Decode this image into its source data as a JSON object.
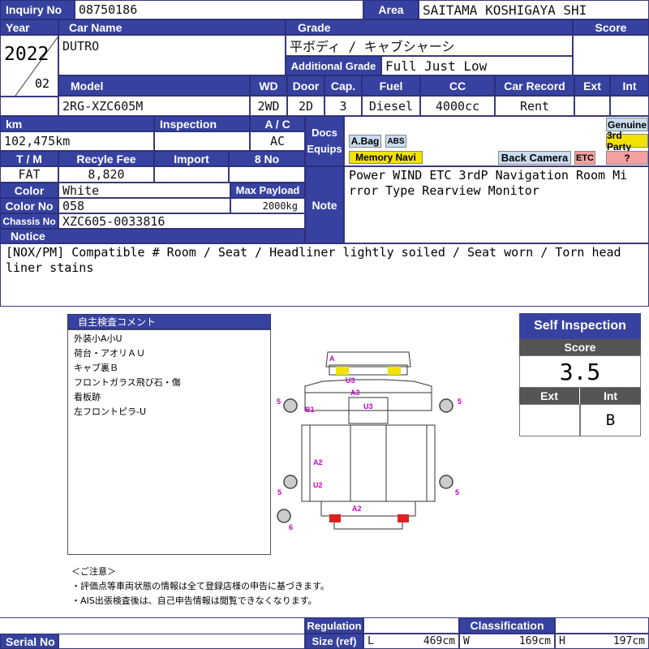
{
  "labels": {
    "inquiry_no": "Inquiry No",
    "area": "Area",
    "year": "Year",
    "car_name": "Car Name",
    "grade": "Grade",
    "score": "Score",
    "additional_grade": "Additional Grade",
    "model": "Model",
    "wd": "WD",
    "door": "Door",
    "cap": "Cap.",
    "fuel": "Fuel",
    "cc": "CC",
    "car_record": "Car Record",
    "ext": "Ext",
    "int": "Int",
    "km": "km",
    "inspection": "Inspection",
    "ac": "A / C",
    "docs": "Docs",
    "equips": "Equips",
    "tm": "T / M",
    "recycle_fee": "Recyle Fee",
    "import": "Import",
    "eight_no": "8 No",
    "color": "Color",
    "max_payload": "Max Payload",
    "color_no": "Color No",
    "note": "Note",
    "chassis_no": "Chassis No",
    "notice": "Notice",
    "serial_no": "Serial No",
    "regulation": "Regulation",
    "size_ref": "Size (ref)",
    "classification": "Classification",
    "L": "L",
    "W": "W",
    "H": "H"
  },
  "values": {
    "inquiry_no": "08750186",
    "area": "SAITAMA KOSHIGAYA SHI",
    "year": "2022",
    "month": "02",
    "car_name": "DUTRO",
    "grade": "平ボディ / キャブシャーシ",
    "additional_grade": "Full Just Low",
    "model": "2RG-XZC605M",
    "wd": "2WD",
    "door": "2D",
    "cap": "3",
    "fuel": "Diesel",
    "cc": "4000cc",
    "car_record": "Rent",
    "km": "102,475km",
    "ac": "AC",
    "tm": "FAT",
    "recycle_fee": "8,820",
    "color": "White",
    "max_payload": "2000kg",
    "color_no": "058",
    "chassis_no": "XZC605-0033816",
    "note_line1": "Power WIND ETC 3rdP Navigation Room Mi",
    "note_line2": "rror Type Rearview Monitor",
    "notice_line1": "[NOX/PM] Compatible # Room / Seat / Headliner lightly soiled / Seat worn / Torn head",
    "notice_line2": "liner stains",
    "size_L": "469cm",
    "size_W": "169cm",
    "size_H": "197cm"
  },
  "equips": {
    "abag": "A.Bag",
    "abs": "ABS",
    "memory_navi": "Memory Navi",
    "back_camera": "Back Camera",
    "etc": "ETC",
    "genuine": "Genuine",
    "third_party": "3rd Party",
    "unknown": "?"
  },
  "colors": {
    "header": "#3742a0",
    "yellow": "#f2e200",
    "blue_badge": "#c9dcf0",
    "pink": "#f4a0a0",
    "magenta": "#c800c8"
  },
  "self_comment": {
    "title": "自主検査コメント",
    "lines": [
      "外装小A小U",
      "荷台・アオリＡＵ",
      "キャブ裏Ｂ",
      "フロントガラス飛び石・傷",
      "看板跡",
      "左フロントピラ-U"
    ]
  },
  "diagram_marks": [
    "A",
    "U3",
    "A3",
    "U3",
    "B1",
    "5",
    "5",
    "A2",
    "U2",
    "5",
    "5",
    "A2",
    "6"
  ],
  "self_inspection": {
    "title": "Self Inspection",
    "score_label": "Score",
    "score": "3.5",
    "ext_label": "Ext",
    "int_label": "Int",
    "ext": "",
    "int": "B"
  },
  "caution": {
    "title": "＜ご注意＞",
    "line1": "・評価点等車両状態の情報は全て登録店様の申告に基づきます。",
    "line2": "・AIS出張検査後は、自己申告情報は閲覧できなくなります。"
  }
}
